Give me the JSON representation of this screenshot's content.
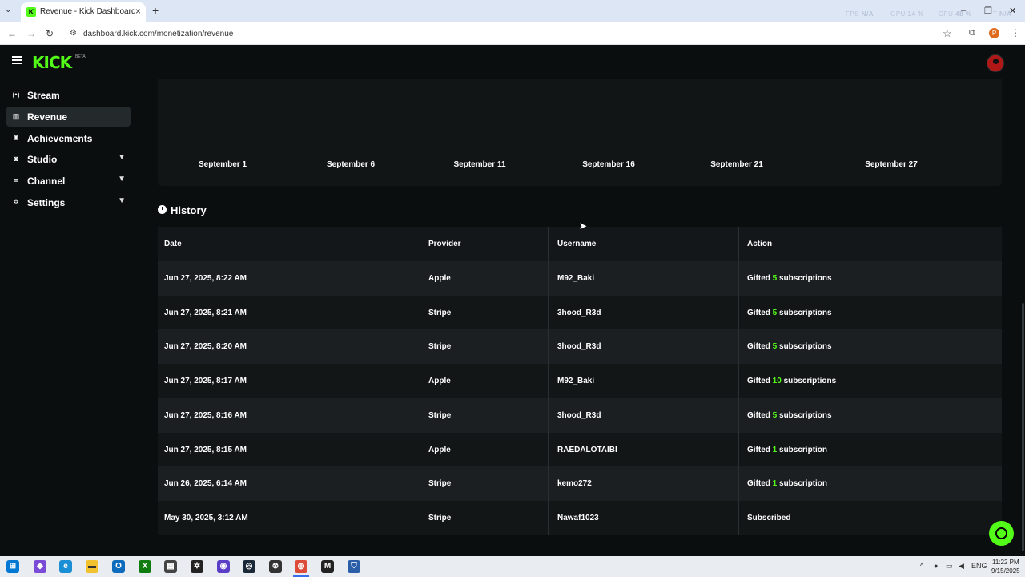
{
  "browser": {
    "tab_title": "Revenue - Kick Dashboard",
    "favicon_letter": "K",
    "url": "dashboard.kick.com/monetization/revenue",
    "overlay": {
      "fps_label": "FPS",
      "fps_value": "N/A",
      "gpu_label": "GPU",
      "gpu_value": "14 %",
      "cpu_label": "CPU",
      "cpu_value": "48 %",
      "extra_label": "T",
      "extra_value": "N/A"
    },
    "profile_initial": "P"
  },
  "header": {
    "logo": "KICK",
    "badge": "BETA"
  },
  "sidebar": {
    "items": [
      {
        "label": "Stream",
        "icon": "broadcast-icon",
        "glyph": "(•)",
        "active": false,
        "expandable": false
      },
      {
        "label": "Revenue",
        "icon": "revenue-icon",
        "glyph": "▥",
        "active": true,
        "expandable": false
      },
      {
        "label": "Achievements",
        "icon": "trophy-icon",
        "glyph": "♜",
        "active": false,
        "expandable": false
      },
      {
        "label": "Studio",
        "icon": "studio-icon",
        "glyph": "◙",
        "active": false,
        "expandable": true
      },
      {
        "label": "Channel",
        "icon": "channel-icon",
        "glyph": "≡",
        "active": false,
        "expandable": true
      },
      {
        "label": "Settings",
        "icon": "gear-icon",
        "glyph": "✲",
        "active": false,
        "expandable": true
      }
    ]
  },
  "chart_data": {
    "type": "line",
    "x_tick_labels": [
      "September 1",
      "September 6",
      "September 11",
      "September 16",
      "September 21",
      "September 27"
    ]
  },
  "history": {
    "title": "History",
    "columns": [
      "Date",
      "Provider",
      "Username",
      "Action"
    ],
    "rows": [
      {
        "date": "Jun 27, 2025, 8:22 AM",
        "provider": "Apple",
        "username": "M92_Baki",
        "action_prefix": "Gifted",
        "count": "5",
        "action_suffix": "subscriptions"
      },
      {
        "date": "Jun 27, 2025, 8:21 AM",
        "provider": "Stripe",
        "username": "3hood_R3d",
        "action_prefix": "Gifted",
        "count": "5",
        "action_suffix": "subscriptions"
      },
      {
        "date": "Jun 27, 2025, 8:20 AM",
        "provider": "Stripe",
        "username": "3hood_R3d",
        "action_prefix": "Gifted",
        "count": "5",
        "action_suffix": "subscriptions"
      },
      {
        "date": "Jun 27, 2025, 8:17 AM",
        "provider": "Apple",
        "username": "M92_Baki",
        "action_prefix": "Gifted",
        "count": "10",
        "action_suffix": "subscriptions"
      },
      {
        "date": "Jun 27, 2025, 8:16 AM",
        "provider": "Stripe",
        "username": "3hood_R3d",
        "action_prefix": "Gifted",
        "count": "5",
        "action_suffix": "subscriptions"
      },
      {
        "date": "Jun 27, 2025, 8:15 AM",
        "provider": "Apple",
        "username": "RAEDALOTAIBI",
        "action_prefix": "Gifted",
        "count": "1",
        "action_suffix": "subscription"
      },
      {
        "date": "Jun 26, 2025, 6:14 AM",
        "provider": "Stripe",
        "username": "kemo272",
        "action_prefix": "Gifted",
        "count": "1",
        "action_suffix": "subscription"
      },
      {
        "date": "May 30, 2025, 3:12 AM",
        "provider": "Stripe",
        "username": "Nawaf1023",
        "action_prefix": "Subscribed",
        "count": "",
        "action_suffix": ""
      }
    ]
  },
  "taskbar": {
    "time": "11:22 PM",
    "date": "9/15/2025",
    "language": "ENG"
  },
  "colors": {
    "accent": "#53fc18",
    "background": "#0b0e0f",
    "card": "#111516"
  }
}
